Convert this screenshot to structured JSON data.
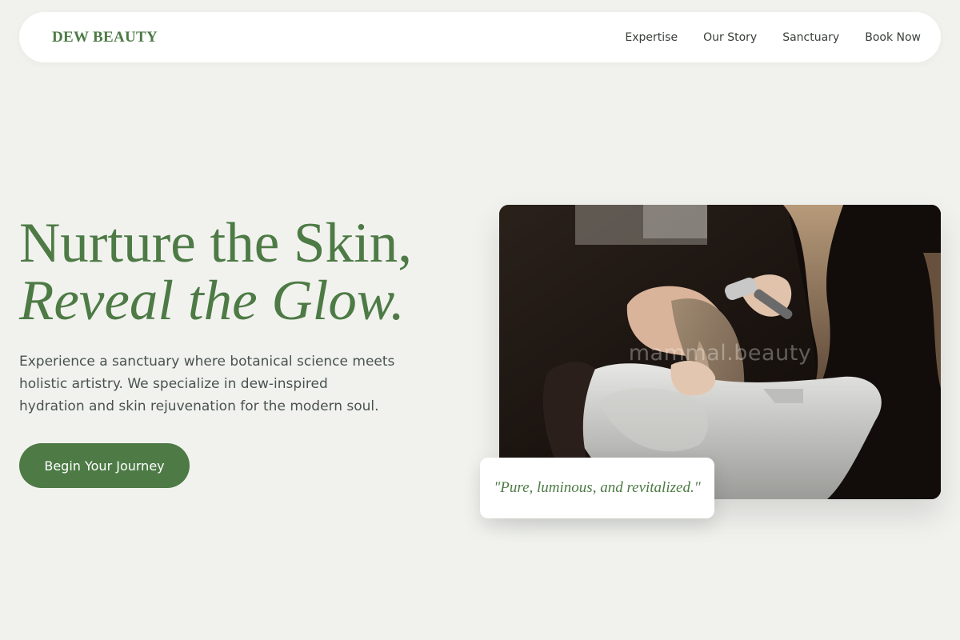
{
  "header": {
    "logo": "DEW BEAUTY",
    "nav": [
      {
        "label": "Expertise"
      },
      {
        "label": "Our Story"
      },
      {
        "label": "Sanctuary"
      },
      {
        "label": "Book Now"
      }
    ]
  },
  "hero": {
    "title_line1": "Nurture the Skin,",
    "title_line2": "Reveal the Glow.",
    "description": "Experience a sanctuary where botanical science meets holistic artistry. We specialize in dew-inspired hydration and skin rejuvenation for the modern soul.",
    "cta_label": "Begin Your Journey"
  },
  "image": {
    "watermark": "mammal.beauty"
  },
  "quote": {
    "text": "\"Pure, luminous, and revitalized.\""
  },
  "colors": {
    "background": "#f1f2ee",
    "accent": "#4d7a45",
    "text": "#4a5250",
    "card": "#ffffff"
  }
}
